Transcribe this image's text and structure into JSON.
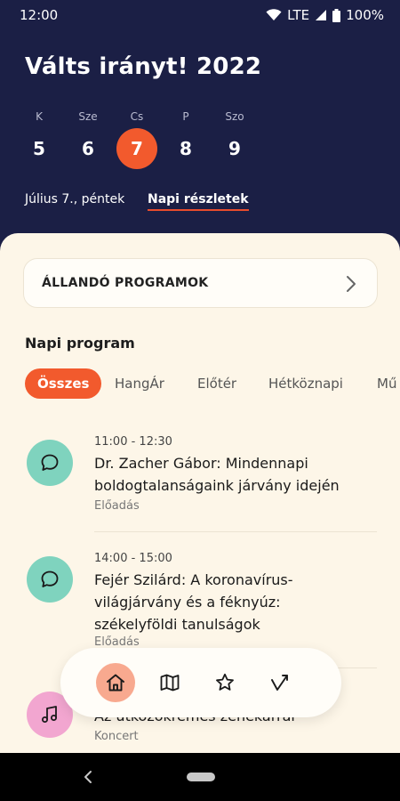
{
  "status": {
    "time": "12:00",
    "network": "LTE",
    "battery": "100%"
  },
  "app": {
    "title": "Válts irányt! 2022"
  },
  "days": [
    {
      "abbr": "K",
      "num": "5"
    },
    {
      "abbr": "Sze",
      "num": "6"
    },
    {
      "abbr": "Cs",
      "num": "7",
      "selected": true
    },
    {
      "abbr": "P",
      "num": "8"
    },
    {
      "abbr": "Szo",
      "num": "9"
    }
  ],
  "date": {
    "label": "Július 7., péntek",
    "details_link": "Napi részletek"
  },
  "permanent": {
    "label": "ÁLLANDÓ PROGRAMOK"
  },
  "program": {
    "title": "Napi program",
    "chips": [
      "Összes",
      "HangÁr",
      "Előtér",
      "Hétköznapi",
      "Mű"
    ]
  },
  "events": [
    {
      "time": "11:00 - 12:30",
      "title": "Dr. Zacher Gábor: Mindennapi boldogtalanságaink járvány idején",
      "type": "Előadás",
      "icon": "chat-bubble-icon",
      "color": "#7fd3be"
    },
    {
      "time": "14:00 - 15:00",
      "title": "Fejér Szilárd: A koronavírus-világjárvány és a féknyúz: székelyföldi tanulságok",
      "type": "Előadás",
      "icon": "chat-bubble-icon",
      "color": "#7fd3be"
    },
    {
      "time": "",
      "title": "Az ütközőkrémes zenekarral",
      "type": "Koncert",
      "icon": "music-note-icon",
      "color": "#f2a6d0"
    }
  ],
  "nav": {
    "items": [
      "home-icon",
      "map-icon",
      "star-icon",
      "route-icon"
    ],
    "active": "home-icon"
  },
  "colors": {
    "primary_dark": "#1b1f45",
    "accent": "#f25a2d",
    "sheet": "#fdf6e8"
  }
}
